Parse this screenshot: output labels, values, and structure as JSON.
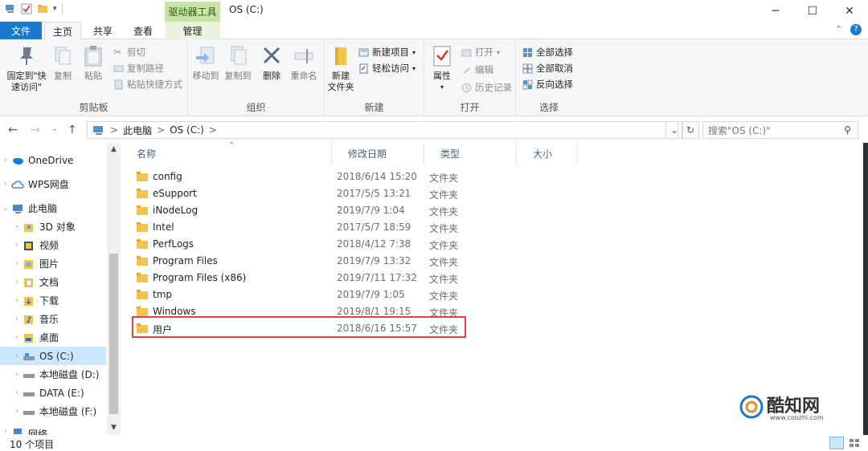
{
  "window": {
    "title": "OS (C:)",
    "context_tab_group": "驱动器工具"
  },
  "ribbon_tabs": {
    "file": "文件",
    "home": "主页",
    "share": "共享",
    "view": "查看",
    "manage": "管理"
  },
  "clipboard": {
    "pin": "固定到\"快速访问\"",
    "copy": "复制",
    "paste": "粘贴",
    "cut": "剪切",
    "copy_path": "复制路径",
    "paste_shortcut": "粘贴快捷方式",
    "label": "剪贴板"
  },
  "organize": {
    "move_to": "移动到",
    "copy_to": "复制到",
    "delete": "删除",
    "rename": "重命名",
    "label": "组织"
  },
  "new": {
    "new_folder_l1": "新建",
    "new_folder_l2": "文件夹",
    "new_item": "新建项目",
    "easy_access": "轻松访问",
    "label": "新建"
  },
  "open": {
    "properties": "属性",
    "open": "打开",
    "edit": "编辑",
    "history": "历史记录",
    "label": "打开"
  },
  "select": {
    "select_all": "全部选择",
    "select_none": "全部取消",
    "invert": "反向选择",
    "label": "选择"
  },
  "address": {
    "crumb1": "此电脑",
    "crumb2": "OS (C:)",
    "sep": ">"
  },
  "search": {
    "placeholder": "搜索\"OS (C:)\""
  },
  "nav": {
    "items": [
      {
        "label": "OneDrive",
        "icon": "cloud-icon"
      },
      {
        "label": "WPS网盘",
        "icon": "cloud-outline-icon"
      },
      {
        "label": "此电脑",
        "icon": "computer-icon"
      },
      {
        "label": "3D 对象",
        "icon": "3d-objects-icon"
      },
      {
        "label": "视频",
        "icon": "video-icon"
      },
      {
        "label": "图片",
        "icon": "picture-icon"
      },
      {
        "label": "文档",
        "icon": "document-icon"
      },
      {
        "label": "下载",
        "icon": "download-icon"
      },
      {
        "label": "音乐",
        "icon": "music-icon"
      },
      {
        "label": "桌面",
        "icon": "desktop-icon"
      },
      {
        "label": "OS (C:)",
        "icon": "drive-icon"
      },
      {
        "label": "本地磁盘 (D:)",
        "icon": "drive-icon"
      },
      {
        "label": "DATA (E:)",
        "icon": "drive-icon"
      },
      {
        "label": "本地磁盘 (F:)",
        "icon": "drive-icon"
      },
      {
        "label": "网络",
        "icon": "network-icon"
      }
    ]
  },
  "columns": {
    "name": "名称",
    "date": "修改日期",
    "type": "类型",
    "size": "大小"
  },
  "files": [
    {
      "name": "config",
      "date": "2018/6/14 15:20",
      "type": "文件夹"
    },
    {
      "name": "eSupport",
      "date": "2017/5/5 13:21",
      "type": "文件夹"
    },
    {
      "name": "iNodeLog",
      "date": "2019/7/9 1:04",
      "type": "文件夹"
    },
    {
      "name": "Intel",
      "date": "2017/5/7 18:59",
      "type": "文件夹"
    },
    {
      "name": "PerfLogs",
      "date": "2018/4/12 7:38",
      "type": "文件夹"
    },
    {
      "name": "Program Files",
      "date": "2019/7/9 13:32",
      "type": "文件夹"
    },
    {
      "name": "Program Files (x86)",
      "date": "2019/7/11 17:32",
      "type": "文件夹"
    },
    {
      "name": "tmp",
      "date": "2019/7/9 1:05",
      "type": "文件夹"
    },
    {
      "name": "Windows",
      "date": "2019/8/1 19:15",
      "type": "文件夹"
    },
    {
      "name": "用户",
      "date": "2018/6/16 15:57",
      "type": "文件夹"
    }
  ],
  "status": {
    "count": "10 个项目"
  },
  "watermark": {
    "brand": "酷知网",
    "url": "www.coozhi.com"
  },
  "colors": {
    "accent": "#1979ca",
    "selection": "#cce8ff",
    "highlight_border": "#e0443c",
    "context_tab": "#c7e4a6"
  }
}
